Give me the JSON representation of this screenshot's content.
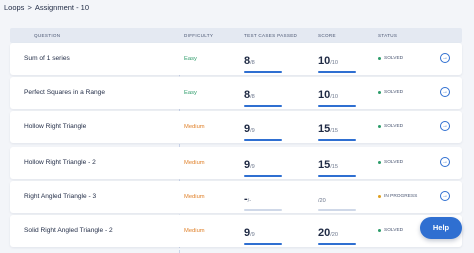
{
  "breadcrumb": {
    "parent": "Loops",
    "separator": ">",
    "current": "Assignment - 10"
  },
  "table": {
    "headers": {
      "question": "QUESTION",
      "difficulty": "DIFFICULTY",
      "test_cases": "TEST CASES PASSED",
      "score": "SCORE",
      "status": "STATUS"
    },
    "rows": [
      {
        "name": "Sum of 1 series",
        "difficulty": "Easy",
        "tests_passed": "8",
        "tests_total": "/8",
        "score": "10",
        "score_max": "/10",
        "status": "SOLVED",
        "test_fraction": 1.0,
        "score_fraction": 1.0
      },
      {
        "name": "Perfect Squares in a Range",
        "difficulty": "Easy",
        "tests_passed": "8",
        "tests_total": "/8",
        "score": "10",
        "score_max": "/10",
        "status": "SOLVED",
        "test_fraction": 1.0,
        "score_fraction": 1.0
      },
      {
        "name": "Hollow Right Triangle",
        "difficulty": "Medium",
        "tests_passed": "9",
        "tests_total": "/9",
        "score": "15",
        "score_max": "/15",
        "status": "SOLVED",
        "test_fraction": 1.0,
        "score_fraction": 1.0
      },
      {
        "name": "Hollow Right Triangle - 2",
        "difficulty": "Medium",
        "tests_passed": "9",
        "tests_total": "/9",
        "score": "15",
        "score_max": "/15",
        "status": "SOLVED",
        "test_fraction": 1.0,
        "score_fraction": 1.0
      },
      {
        "name": "Right Angled Triangle - 3",
        "difficulty": "Medium",
        "tests_passed": "-",
        "tests_total": "/-",
        "score": "",
        "score_max": "/20",
        "status": "IN PROGRESS",
        "test_fraction": 0.0,
        "score_fraction": 0.0
      },
      {
        "name": "Solid Right Angled Triangle - 2",
        "difficulty": "Medium",
        "tests_passed": "9",
        "tests_total": "/9",
        "score": "20",
        "score_max": "/20",
        "status": "SOLVED",
        "test_fraction": 1.0,
        "score_fraction": 1.0
      }
    ]
  },
  "colors": {
    "accent": "#2f6fd1",
    "easy": "#2d9c6a",
    "medium": "#e0822b",
    "solved": "#2d9c6a",
    "in_progress": "#e0a020"
  },
  "icons": {
    "open": "arrow-right-circle-icon"
  },
  "help": {
    "label": "Help"
  }
}
